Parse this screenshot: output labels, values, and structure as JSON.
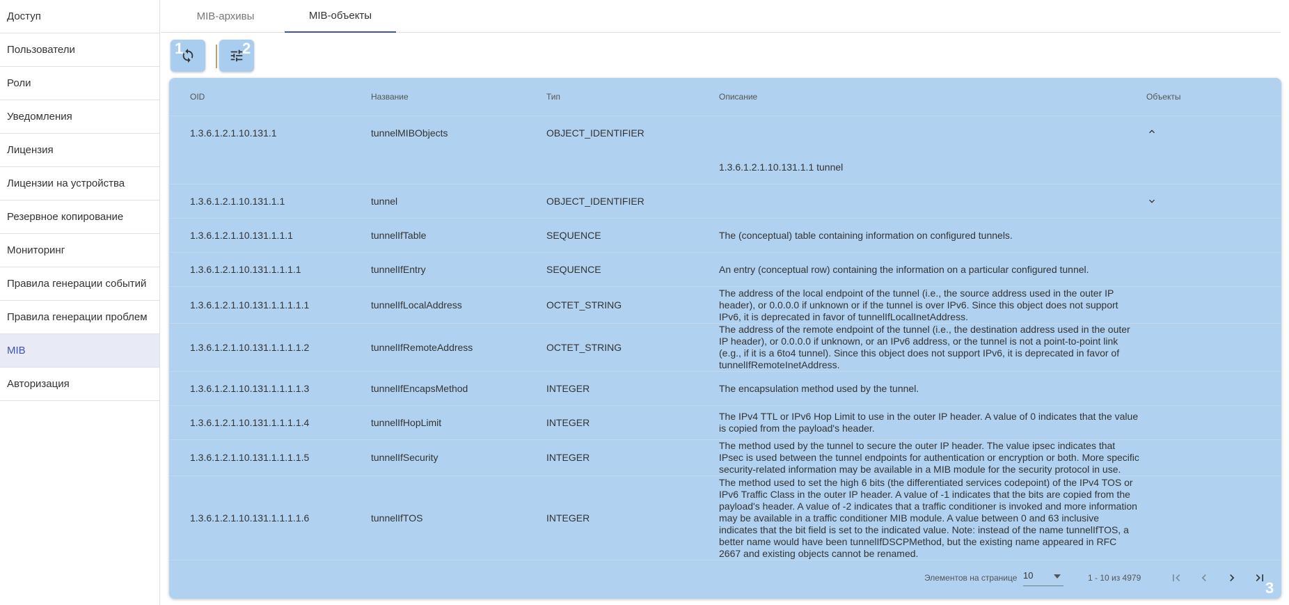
{
  "sidebar": {
    "items": [
      {
        "label": "Доступ"
      },
      {
        "label": "Пользователи"
      },
      {
        "label": "Роли"
      },
      {
        "label": "Уведомления"
      },
      {
        "label": "Лицензия"
      },
      {
        "label": "Лицензии на устройства"
      },
      {
        "label": "Резервное копирование"
      },
      {
        "label": "Мониторинг"
      },
      {
        "label": "Правила генерации событий"
      },
      {
        "label": "Правила генерации проблем"
      },
      {
        "label": "MIB",
        "active": true
      },
      {
        "label": "Авторизация"
      }
    ]
  },
  "tabs": [
    {
      "label": "MIB-архивы"
    },
    {
      "label": "MIB-объекты",
      "active": true
    }
  ],
  "toolbar": {
    "refresh_icon": "refresh-icon",
    "filter_icon": "tune-icon",
    "marker_1": "1",
    "marker_2": "2",
    "marker_3": "3"
  },
  "table": {
    "headers": {
      "oid": "OID",
      "name": "Название",
      "type": "Тип",
      "description": "Описание",
      "objects": "Объекты"
    },
    "rows": [
      {
        "oid": "1.3.6.1.2.1.10.131.1",
        "name": "tunnelMIBObjects",
        "type": "OBJECT_IDENTIFIER",
        "description": "",
        "expanded": true,
        "child": "1.3.6.1.2.1.10.131.1.1 tunnel"
      },
      {
        "oid": "1.3.6.1.2.1.10.131.1.1",
        "name": "tunnel",
        "type": "OBJECT_IDENTIFIER",
        "description": ""
      },
      {
        "oid": "1.3.6.1.2.1.10.131.1.1.1",
        "name": "tunnelIfTable",
        "type": "SEQUENCE",
        "description": "The (conceptual) table containing information on configured tunnels."
      },
      {
        "oid": "1.3.6.1.2.1.10.131.1.1.1.1",
        "name": "tunnelIfEntry",
        "type": "SEQUENCE",
        "description": "An entry (conceptual row) containing the information on a particular configured tunnel."
      },
      {
        "oid": "1.3.6.1.2.1.10.131.1.1.1.1.1",
        "name": "tunnelIfLocalAddress",
        "type": "OCTET_STRING",
        "description": "The address of the local endpoint of the tunnel (i.e., the source address used in the outer IP header), or 0.0.0.0 if unknown or if the tunnel is over IPv6. Since this object does not support IPv6, it is deprecated in favor of tunnelIfLocalInetAddress."
      },
      {
        "oid": "1.3.6.1.2.1.10.131.1.1.1.1.2",
        "name": "tunnelIfRemoteAddress",
        "type": "OCTET_STRING",
        "description": "The address of the remote endpoint of the tunnel (i.e., the destination address used in the outer IP header), or 0.0.0.0 if unknown, or an IPv6 address, or the tunnel is not a point-to-point link (e.g., if it is a 6to4 tunnel). Since this object does not support IPv6, it is deprecated in favor of tunnelIfRemoteInetAddress."
      },
      {
        "oid": "1.3.6.1.2.1.10.131.1.1.1.1.3",
        "name": "tunnelIfEncapsMethod",
        "type": "INTEGER",
        "description": "The encapsulation method used by the tunnel."
      },
      {
        "oid": "1.3.6.1.2.1.10.131.1.1.1.1.4",
        "name": "tunnelIfHopLimit",
        "type": "INTEGER",
        "description": "The IPv4 TTL or IPv6 Hop Limit to use in the outer IP header. A value of 0 indicates that the value is copied from the payload's header."
      },
      {
        "oid": "1.3.6.1.2.1.10.131.1.1.1.1.5",
        "name": "tunnelIfSecurity",
        "type": "INTEGER",
        "description": "The method used by the tunnel to secure the outer IP header. The value ipsec indicates that IPsec is used between the tunnel endpoints for authentication or encryption or both. More specific security-related information may be available in a MIB module for the security protocol in use."
      },
      {
        "oid": "1.3.6.1.2.1.10.131.1.1.1.1.6",
        "name": "tunnelIfTOS",
        "type": "INTEGER",
        "description": "The method used to set the high 6 bits (the differentiated services codepoint) of the IPv4 TOS or IPv6 Traffic Class in the outer IP header. A value of -1 indicates that the bits are copied from the payload's header. A value of -2 indicates that a traffic conditioner is invoked and more information may be available in a traffic conditioner MIB module. A value between 0 and 63 inclusive indicates that the bit field is set to the indicated value. Note: instead of the name tunnelIfTOS, a better name would have been tunnelIfDSCPMethod, but the existing name appeared in RFC 2667 and existing objects cannot be renamed."
      }
    ]
  },
  "pagination": {
    "page_size_label": "Элементов на странице",
    "page_size": "10",
    "range": "1 - 10 из 4979"
  },
  "colors": {
    "panel": "#b0d2f0",
    "accent": "#3f51b5"
  }
}
